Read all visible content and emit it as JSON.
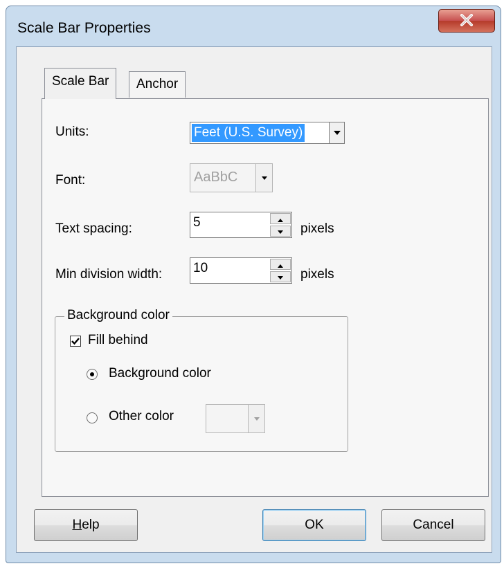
{
  "window": {
    "title": "Scale Bar Properties"
  },
  "tabs": {
    "scale_bar": "Scale Bar",
    "anchor": "Anchor"
  },
  "fields": {
    "units_label": "Units:",
    "units_value": "Feet (U.S. Survey)",
    "font_label": "Font:",
    "font_value": "AaBbC",
    "text_spacing_label": "Text spacing:",
    "text_spacing_value": "5",
    "text_spacing_unit": "pixels",
    "min_division_label": "Min division width:",
    "min_division_value": "10",
    "min_division_unit": "pixels"
  },
  "background_group": {
    "legend": "Background color",
    "fill_behind_label": "Fill behind",
    "fill_behind_checked": true,
    "radio_background_label": "Background color",
    "radio_other_label": "Other color",
    "selected_radio": "background"
  },
  "buttons": {
    "help_prefix": "H",
    "help_rest": "elp",
    "ok": "OK",
    "cancel": "Cancel"
  },
  "colors": {
    "selection": "#3399ff",
    "close_button": "#c75050",
    "frame": "#c9dcee"
  }
}
